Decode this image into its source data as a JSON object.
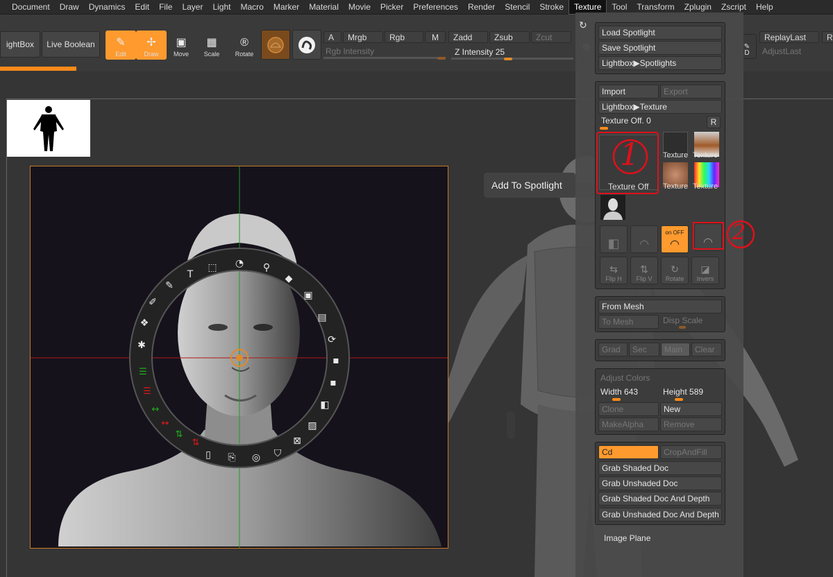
{
  "menu": [
    "Document",
    "Draw",
    "Dynamics",
    "Edit",
    "File",
    "Layer",
    "Light",
    "Macro",
    "Marker",
    "Material",
    "Movie",
    "Picker",
    "Preferences",
    "Render",
    "Stencil",
    "Stroke",
    "Texture",
    "Tool",
    "Transform",
    "Zplugin",
    "Zscript",
    "Help"
  ],
  "active_menu": "Texture",
  "toolbar": {
    "lightbox": "ightBox",
    "live_boolean": "Live Boolean",
    "edit": "Edit",
    "draw": "Draw",
    "move": "Move",
    "scale": "Scale",
    "rotate": "Rotate",
    "a": "A",
    "mrgb": "Mrgb",
    "rgb": "Rgb",
    "m": "M",
    "zadd": "Zadd",
    "zsub": "Zsub",
    "zcut": "Zcut",
    "rgb_intensity": "Rgb Intensity",
    "z_intensity_label": "Z Intensity",
    "z_intensity_value": "25",
    "replay_last": "ReplayLast",
    "adjust_last": "AdjustLast",
    "re": "Re",
    "d": "D",
    "progress_fraction": 0.22
  },
  "tooltip": "Add To Spotlight",
  "panel": {
    "load_spotlight": "Load Spotlight",
    "save_spotlight": "Save Spotlight",
    "lightbox_spotlights": "Lightbox▶Spotlights",
    "import": "Import",
    "export": "Export",
    "lightbox_texture": "Lightbox▶Texture",
    "texture_off_label": "Texture Off.",
    "texture_off_value": "0",
    "r": "R",
    "texture_off_swatch": "Texture Off",
    "texture": "Texture",
    "on": "on",
    "off": "OFF",
    "flip_h": "Flip H",
    "flip_v": "Flip V",
    "rotate": "Rotate",
    "invers": "Invers",
    "from_mesh": "From Mesh",
    "to_mesh": "To Mesh",
    "disp_scale": "Disp Scale",
    "grad": "Grad",
    "sec": "Sec",
    "main": "Main",
    "clear": "Clear",
    "adjust_colors": "Adjust Colors",
    "width_label": "Width",
    "width_value": "643",
    "height_label": "Height",
    "height_value": "589",
    "clone": "Clone",
    "new": "New",
    "make_alpha": "MakeAlpha",
    "remove": "Remove",
    "cd": "Cd",
    "crop_and_fill": "CropAndFill",
    "grab_shaded_doc": "Grab Shaded Doc",
    "grab_unshaded_doc": "Grab Unshaded Doc",
    "grab_shaded_doc_depth": "Grab Shaded Doc And Depth",
    "grab_unshaded_doc_depth": "Grab Unshaded Doc And Depth",
    "image_plane": "Image Plane"
  },
  "annotations": {
    "mark1": "1",
    "mark2": "2"
  },
  "colors": {
    "accent": "#ff9a2e",
    "annotation_red": "#e0101a",
    "panel_bg": "#3c3c3c"
  }
}
